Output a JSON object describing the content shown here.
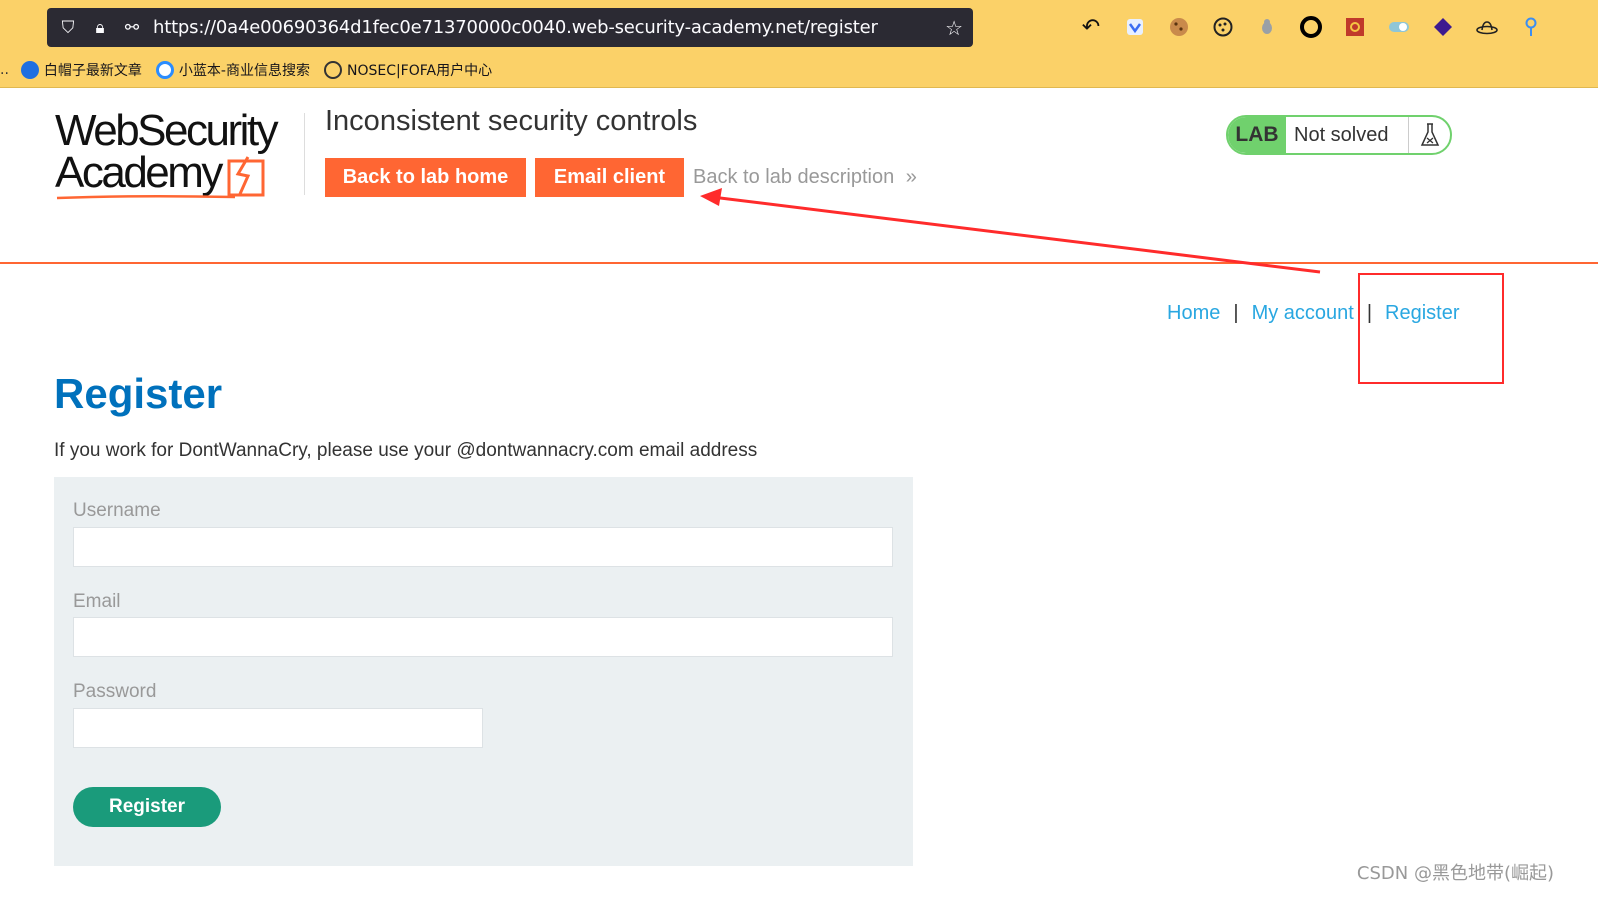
{
  "browser": {
    "url": "https://0a4e00690364d1fec0e71370000c0040.web-security-academy.net/register",
    "bookmarks": [
      {
        "label": "白帽子最新文章",
        "color": "#1e6fe0"
      },
      {
        "label": "小蓝本-商业信息搜索",
        "color": "#2a8cff"
      },
      {
        "label": "NOSEC|FOFA用户中心",
        "color": "#333333"
      }
    ],
    "extensions": [
      "undo-icon",
      "wappalyzer-icon",
      "cookie-icon",
      "cookie-editor-icon",
      "bug-icon",
      "circle-icon",
      "hackbar-icon",
      "toggle-icon",
      "diamond-icon",
      "hat-icon",
      "pin-icon"
    ]
  },
  "logo": {
    "line1": "WebSecurity",
    "line2": "Academy"
  },
  "lab": {
    "title": "Inconsistent security controls",
    "back_home": "Back to lab home",
    "email_client": "Email client",
    "back_description": "Back to lab description",
    "badge_tag": "LAB",
    "status": "Not solved"
  },
  "nav": {
    "home": "Home",
    "account": "My account",
    "register": "Register",
    "separator": "|"
  },
  "page": {
    "title": "Register",
    "notice": "If you work for DontWannaCry, please use your @dontwannacry.com email address"
  },
  "form": {
    "username_label": "Username",
    "email_label": "Email",
    "password_label": "Password",
    "username_value": "",
    "email_value": "",
    "password_value": "",
    "submit": "Register"
  },
  "watermark": "CSDN @黑色地带(崛起)",
  "colors": {
    "accent_orange": "#ff6633",
    "link_blue": "#29a7e1",
    "title_blue": "#0071bc",
    "register_green": "#1a9b7b",
    "lab_green": "#70d16d",
    "annotation_red": "#ff2b2b"
  }
}
